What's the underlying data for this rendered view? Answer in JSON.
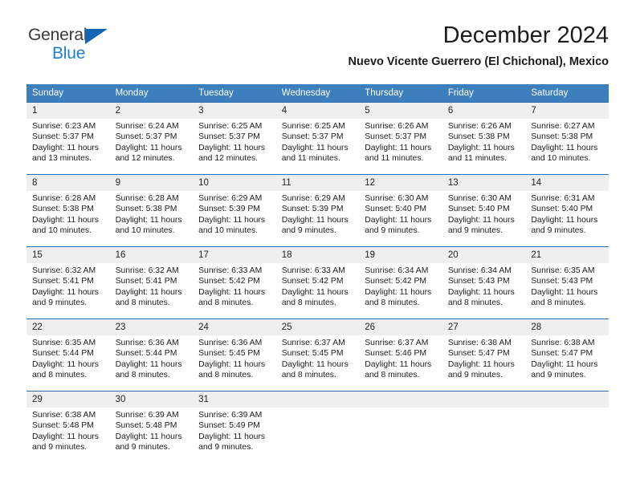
{
  "brand": {
    "name_part1": "General",
    "name_part2": "Blue",
    "colors": {
      "dark": "#3a3a3a",
      "blue": "#1a7fd4",
      "triangle": "#1565b5"
    }
  },
  "header": {
    "title": "December 2024",
    "subtitle": "Nuevo Vicente Guerrero (El Chichonal), Mexico"
  },
  "calendar": {
    "header_bg": "#3d7ebd",
    "row_border": "#2f6fb0",
    "daynum_bg": "#efeff0",
    "weekdays": [
      "Sunday",
      "Monday",
      "Tuesday",
      "Wednesday",
      "Thursday",
      "Friday",
      "Saturday"
    ],
    "weeks": [
      [
        {
          "day": "1",
          "sunrise": "Sunrise: 6:23 AM",
          "sunset": "Sunset: 5:37 PM",
          "daylight1": "Daylight: 11 hours",
          "daylight2": "and 13 minutes."
        },
        {
          "day": "2",
          "sunrise": "Sunrise: 6:24 AM",
          "sunset": "Sunset: 5:37 PM",
          "daylight1": "Daylight: 11 hours",
          "daylight2": "and 12 minutes."
        },
        {
          "day": "3",
          "sunrise": "Sunrise: 6:25 AM",
          "sunset": "Sunset: 5:37 PM",
          "daylight1": "Daylight: 11 hours",
          "daylight2": "and 12 minutes."
        },
        {
          "day": "4",
          "sunrise": "Sunrise: 6:25 AM",
          "sunset": "Sunset: 5:37 PM",
          "daylight1": "Daylight: 11 hours",
          "daylight2": "and 11 minutes."
        },
        {
          "day": "5",
          "sunrise": "Sunrise: 6:26 AM",
          "sunset": "Sunset: 5:37 PM",
          "daylight1": "Daylight: 11 hours",
          "daylight2": "and 11 minutes."
        },
        {
          "day": "6",
          "sunrise": "Sunrise: 6:26 AM",
          "sunset": "Sunset: 5:38 PM",
          "daylight1": "Daylight: 11 hours",
          "daylight2": "and 11 minutes."
        },
        {
          "day": "7",
          "sunrise": "Sunrise: 6:27 AM",
          "sunset": "Sunset: 5:38 PM",
          "daylight1": "Daylight: 11 hours",
          "daylight2": "and 10 minutes."
        }
      ],
      [
        {
          "day": "8",
          "sunrise": "Sunrise: 6:28 AM",
          "sunset": "Sunset: 5:38 PM",
          "daylight1": "Daylight: 11 hours",
          "daylight2": "and 10 minutes."
        },
        {
          "day": "9",
          "sunrise": "Sunrise: 6:28 AM",
          "sunset": "Sunset: 5:38 PM",
          "daylight1": "Daylight: 11 hours",
          "daylight2": "and 10 minutes."
        },
        {
          "day": "10",
          "sunrise": "Sunrise: 6:29 AM",
          "sunset": "Sunset: 5:39 PM",
          "daylight1": "Daylight: 11 hours",
          "daylight2": "and 10 minutes."
        },
        {
          "day": "11",
          "sunrise": "Sunrise: 6:29 AM",
          "sunset": "Sunset: 5:39 PM",
          "daylight1": "Daylight: 11 hours",
          "daylight2": "and 9 minutes."
        },
        {
          "day": "12",
          "sunrise": "Sunrise: 6:30 AM",
          "sunset": "Sunset: 5:40 PM",
          "daylight1": "Daylight: 11 hours",
          "daylight2": "and 9 minutes."
        },
        {
          "day": "13",
          "sunrise": "Sunrise: 6:30 AM",
          "sunset": "Sunset: 5:40 PM",
          "daylight1": "Daylight: 11 hours",
          "daylight2": "and 9 minutes."
        },
        {
          "day": "14",
          "sunrise": "Sunrise: 6:31 AM",
          "sunset": "Sunset: 5:40 PM",
          "daylight1": "Daylight: 11 hours",
          "daylight2": "and 9 minutes."
        }
      ],
      [
        {
          "day": "15",
          "sunrise": "Sunrise: 6:32 AM",
          "sunset": "Sunset: 5:41 PM",
          "daylight1": "Daylight: 11 hours",
          "daylight2": "and 9 minutes."
        },
        {
          "day": "16",
          "sunrise": "Sunrise: 6:32 AM",
          "sunset": "Sunset: 5:41 PM",
          "daylight1": "Daylight: 11 hours",
          "daylight2": "and 8 minutes."
        },
        {
          "day": "17",
          "sunrise": "Sunrise: 6:33 AM",
          "sunset": "Sunset: 5:42 PM",
          "daylight1": "Daylight: 11 hours",
          "daylight2": "and 8 minutes."
        },
        {
          "day": "18",
          "sunrise": "Sunrise: 6:33 AM",
          "sunset": "Sunset: 5:42 PM",
          "daylight1": "Daylight: 11 hours",
          "daylight2": "and 8 minutes."
        },
        {
          "day": "19",
          "sunrise": "Sunrise: 6:34 AM",
          "sunset": "Sunset: 5:42 PM",
          "daylight1": "Daylight: 11 hours",
          "daylight2": "and 8 minutes."
        },
        {
          "day": "20",
          "sunrise": "Sunrise: 6:34 AM",
          "sunset": "Sunset: 5:43 PM",
          "daylight1": "Daylight: 11 hours",
          "daylight2": "and 8 minutes."
        },
        {
          "day": "21",
          "sunrise": "Sunrise: 6:35 AM",
          "sunset": "Sunset: 5:43 PM",
          "daylight1": "Daylight: 11 hours",
          "daylight2": "and 8 minutes."
        }
      ],
      [
        {
          "day": "22",
          "sunrise": "Sunrise: 6:35 AM",
          "sunset": "Sunset: 5:44 PM",
          "daylight1": "Daylight: 11 hours",
          "daylight2": "and 8 minutes."
        },
        {
          "day": "23",
          "sunrise": "Sunrise: 6:36 AM",
          "sunset": "Sunset: 5:44 PM",
          "daylight1": "Daylight: 11 hours",
          "daylight2": "and 8 minutes."
        },
        {
          "day": "24",
          "sunrise": "Sunrise: 6:36 AM",
          "sunset": "Sunset: 5:45 PM",
          "daylight1": "Daylight: 11 hours",
          "daylight2": "and 8 minutes."
        },
        {
          "day": "25",
          "sunrise": "Sunrise: 6:37 AM",
          "sunset": "Sunset: 5:45 PM",
          "daylight1": "Daylight: 11 hours",
          "daylight2": "and 8 minutes."
        },
        {
          "day": "26",
          "sunrise": "Sunrise: 6:37 AM",
          "sunset": "Sunset: 5:46 PM",
          "daylight1": "Daylight: 11 hours",
          "daylight2": "and 8 minutes."
        },
        {
          "day": "27",
          "sunrise": "Sunrise: 6:38 AM",
          "sunset": "Sunset: 5:47 PM",
          "daylight1": "Daylight: 11 hours",
          "daylight2": "and 9 minutes."
        },
        {
          "day": "28",
          "sunrise": "Sunrise: 6:38 AM",
          "sunset": "Sunset: 5:47 PM",
          "daylight1": "Daylight: 11 hours",
          "daylight2": "and 9 minutes."
        }
      ],
      [
        {
          "day": "29",
          "sunrise": "Sunrise: 6:38 AM",
          "sunset": "Sunset: 5:48 PM",
          "daylight1": "Daylight: 11 hours",
          "daylight2": "and 9 minutes."
        },
        {
          "day": "30",
          "sunrise": "Sunrise: 6:39 AM",
          "sunset": "Sunset: 5:48 PM",
          "daylight1": "Daylight: 11 hours",
          "daylight2": "and 9 minutes."
        },
        {
          "day": "31",
          "sunrise": "Sunrise: 6:39 AM",
          "sunset": "Sunset: 5:49 PM",
          "daylight1": "Daylight: 11 hours",
          "daylight2": "and 9 minutes."
        },
        {
          "day": "",
          "sunrise": "",
          "sunset": "",
          "daylight1": "",
          "daylight2": ""
        },
        {
          "day": "",
          "sunrise": "",
          "sunset": "",
          "daylight1": "",
          "daylight2": ""
        },
        {
          "day": "",
          "sunrise": "",
          "sunset": "",
          "daylight1": "",
          "daylight2": ""
        },
        {
          "day": "",
          "sunrise": "",
          "sunset": "",
          "daylight1": "",
          "daylight2": ""
        }
      ]
    ]
  }
}
